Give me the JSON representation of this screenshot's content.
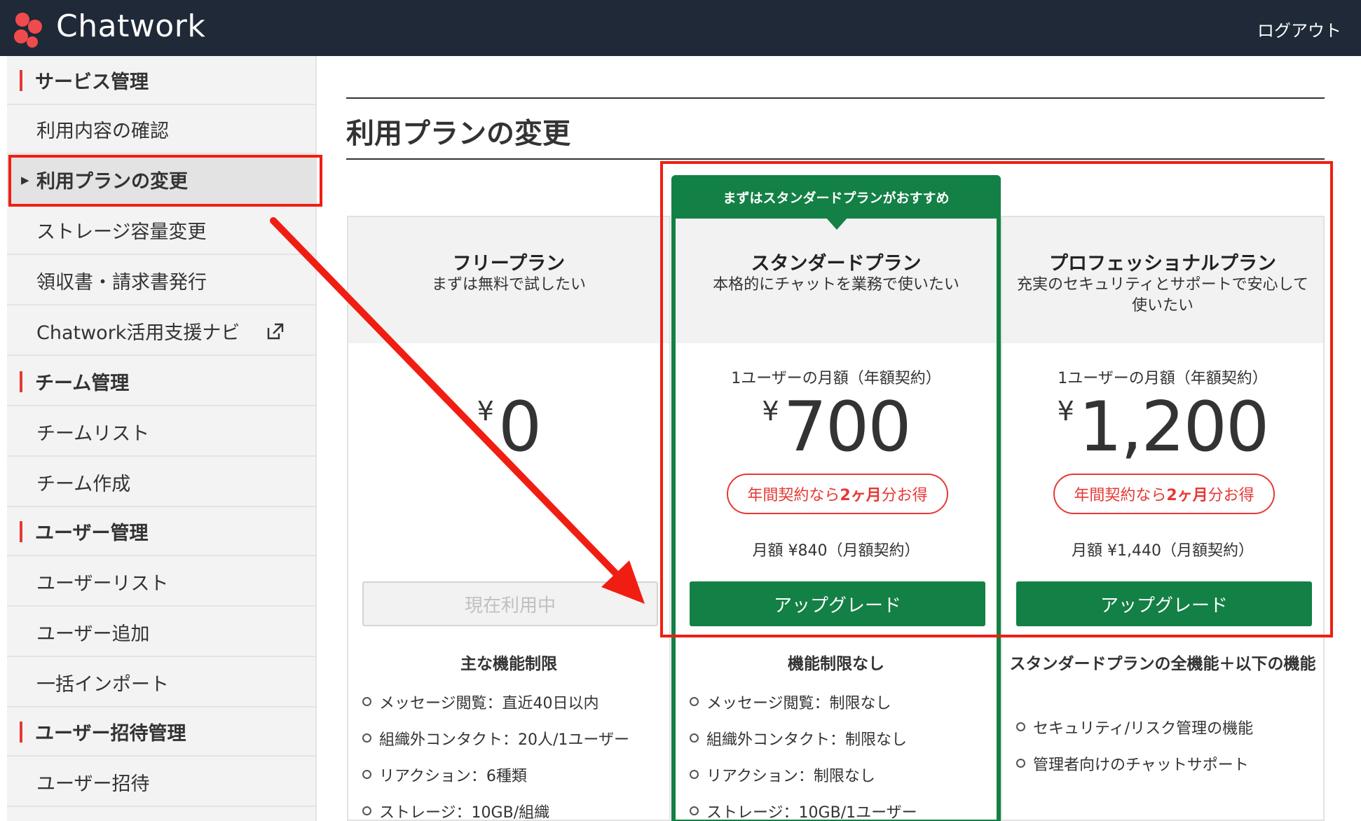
{
  "header": {
    "logo_text": "Chatwork",
    "logout": "ログアウト"
  },
  "sidebar": {
    "items": [
      {
        "label": "サービス管理",
        "type": "section"
      },
      {
        "label": "利用内容の確認",
        "type": "item"
      },
      {
        "label": "利用プランの変更",
        "type": "item",
        "active": true
      },
      {
        "label": "ストレージ容量変更",
        "type": "item"
      },
      {
        "label": "領収書・請求書発行",
        "type": "item"
      },
      {
        "label": "Chatwork活用支援ナビ",
        "type": "item",
        "icon": "external-link-icon"
      },
      {
        "label": "チーム管理",
        "type": "section"
      },
      {
        "label": "チームリスト",
        "type": "item"
      },
      {
        "label": "チーム作成",
        "type": "item"
      },
      {
        "label": "ユーザー管理",
        "type": "section"
      },
      {
        "label": "ユーザーリスト",
        "type": "item"
      },
      {
        "label": "ユーザー追加",
        "type": "item"
      },
      {
        "label": "一括インポート",
        "type": "item"
      },
      {
        "label": "ユーザー招待管理",
        "type": "section"
      },
      {
        "label": "ユーザー招待",
        "type": "item"
      }
    ]
  },
  "main": {
    "title": "利用プランの変更",
    "recommend_banner": "まずはスタンダードプランがおすすめ",
    "plans": [
      {
        "name": "フリープラン",
        "subtitle": "まずは無料で試したい",
        "price_note": "",
        "currency": "¥",
        "price": "0",
        "badge_pre": "",
        "badge_em": "",
        "badge_post": "",
        "monthly": "",
        "button": "現在利用中",
        "features_heading": "主な機能制限",
        "features": [
          "メッセージ閲覧：直近40日以内",
          "組織外コンタクト：20人/1ユーザー",
          "リアクション：6種類",
          "ストレージ：10GB/組織"
        ]
      },
      {
        "name": "スタンダードプラン",
        "subtitle": "本格的にチャットを業務で使いたい",
        "price_note": "1ユーザーの月額（年額契約）",
        "currency": "¥",
        "price": "700",
        "badge_pre": "年間契約なら",
        "badge_em": "2ヶ月",
        "badge_post": "分お得",
        "monthly": "月額 ¥840（月額契約）",
        "button": "アップグレード",
        "features_heading": "機能制限なし",
        "features": [
          "メッセージ閲覧：制限なし",
          "組織外コンタクト：制限なし",
          "リアクション：制限なし",
          "ストレージ：10GB/1ユーザー"
        ]
      },
      {
        "name": "プロフェッショナルプラン",
        "subtitle": "充実のセキュリティとサポートで安心して使いたい",
        "price_note": "1ユーザーの月額（年額契約）",
        "currency": "¥",
        "price": "1,200",
        "badge_pre": "年間契約なら",
        "badge_em": "2ヶ月",
        "badge_post": "分お得",
        "monthly": "月額 ¥1,440（月額契約）",
        "button": "アップグレード",
        "features_heading": "スタンダードプランの全機能＋以下の機能",
        "features": [
          "セキュリティ/リスク管理の機能",
          "管理者向けのチャットサポート"
        ]
      }
    ]
  },
  "colors": {
    "header_bg": "#1f2937",
    "accent_green": "#138045",
    "accent_red": "#e53935",
    "annotation_red": "#f01e12"
  }
}
